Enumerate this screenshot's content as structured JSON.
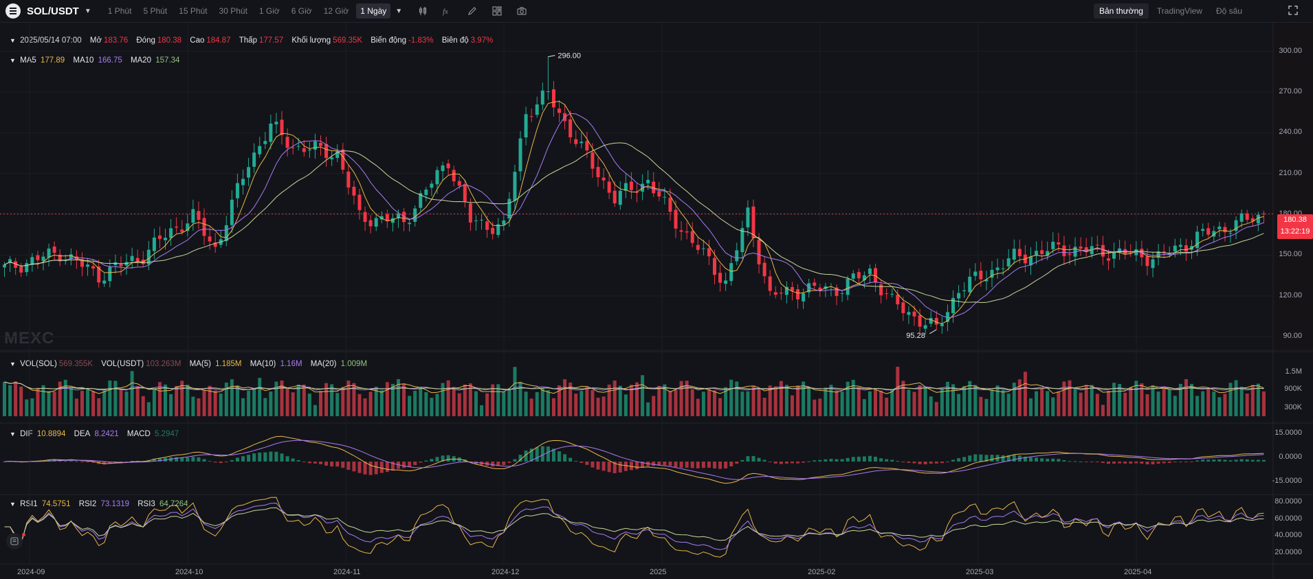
{
  "header": {
    "symbol": "SOL/USDT",
    "intervals": [
      "1 Phút",
      "5 Phút",
      "15 Phút",
      "30 Phút",
      "1 Giờ",
      "6 Giờ",
      "12 Giờ",
      "1 Ngày"
    ],
    "active_interval": "1 Ngày",
    "views": [
      "Bản thường",
      "TradingView",
      "Độ sâu"
    ],
    "active_view": "Bản thường",
    "tool_icons": [
      "candle-type-icon",
      "indicator-fx-icon",
      "draw-pencil-icon",
      "layout-grid-icon",
      "camera-icon"
    ]
  },
  "ohlc": {
    "date": "2025/05/14 07:00",
    "open_label": "Mở",
    "open": "183.76",
    "close_label": "Đóng",
    "close": "180.38",
    "high_label": "Cao",
    "high": "184.87",
    "low_label": "Thấp",
    "low": "177.57",
    "volume_label": "Khối lượng",
    "volume": "569.35K",
    "change_label": "Biến động",
    "change": "-1.83%",
    "amplitude_label": "Biên độ",
    "amplitude": "3.97%"
  },
  "ma": {
    "ma5_label": "MA5",
    "ma5": "177.89",
    "ma10_label": "MA10",
    "ma10": "166.75",
    "ma20_label": "MA20",
    "ma20": "157.34"
  },
  "volume_panel": {
    "sol_label": "VOL(SOL)",
    "sol": "569.355K",
    "usdt_label": "VOL(USDT)",
    "usdt": "103.263M",
    "ma5_label": "MA(5)",
    "ma5": "1.185M",
    "ma10_label": "MA(10)",
    "ma10": "1.16M",
    "ma20_label": "MA(20)",
    "ma20": "1.009M",
    "y_ticks": [
      "1.5M",
      "900K",
      "300K"
    ]
  },
  "macd_panel": {
    "dif_label": "DIF",
    "dif": "10.8894",
    "dea_label": "DEA",
    "dea": "8.2421",
    "macd_label": "MACD",
    "macd": "5.2947",
    "y_ticks": [
      "15.0000",
      "0.0000",
      "-15.0000"
    ]
  },
  "rsi_panel": {
    "rsi1_label": "RSI1",
    "rsi1": "74.5751",
    "rsi2_label": "RSI2",
    "rsi2": "73.1319",
    "rsi3_label": "RSI3",
    "rsi3": "64.7264",
    "y_ticks": [
      "80.0000",
      "60.0000",
      "40.0000",
      "20.0000"
    ]
  },
  "price_axis": {
    "ticks": [
      "300.00",
      "270.00",
      "240.00",
      "210.00",
      "180.00",
      "150.00",
      "120.00",
      "90.00"
    ],
    "current_price": "180.38",
    "countdown": "13:22:19"
  },
  "annotations": {
    "max_label": "296.00",
    "min_label": "95.28"
  },
  "x_axis": [
    "2024-09",
    "2024-10",
    "2024-11",
    "2024-12",
    "2025",
    "2025-02",
    "2025-03",
    "2025-04"
  ],
  "watermark": "MEXC",
  "colors": {
    "up": "#22ab94",
    "down": "#f23645",
    "ma5": "#e9b84b",
    "ma10": "#a97cf6",
    "ma20": "#c8d79a",
    "background": "#131419"
  },
  "chart_data": {
    "type": "candlestick",
    "price_range": [
      80,
      315
    ],
    "max_annotation": 296.0,
    "min_annotation": 95.28,
    "current_price": 180.38,
    "x_ticks": [
      "2024-09",
      "2024-10",
      "2024-11",
      "2024-12",
      "2025",
      "2025-02",
      "2025-03",
      "2025-04"
    ],
    "anchor_closes": [
      [
        0,
        140
      ],
      [
        10,
        152
      ],
      [
        17,
        135
      ],
      [
        25,
        150
      ],
      [
        30,
        168
      ],
      [
        34,
        178
      ],
      [
        38,
        155
      ],
      [
        44,
        218
      ],
      [
        48,
        245
      ],
      [
        52,
        230
      ],
      [
        60,
        225
      ],
      [
        64,
        178
      ],
      [
        72,
        175
      ],
      [
        80,
        220
      ],
      [
        84,
        175
      ],
      [
        90,
        170
      ],
      [
        94,
        255
      ],
      [
        98,
        268
      ],
      [
        104,
        228
      ],
      [
        110,
        192
      ],
      [
        116,
        205
      ],
      [
        120,
        180
      ],
      [
        130,
        130
      ],
      [
        134,
        180
      ],
      [
        138,
        120
      ],
      [
        144,
        125
      ],
      [
        150,
        125
      ],
      [
        156,
        138
      ],
      [
        160,
        115
      ],
      [
        168,
        95
      ],
      [
        172,
        125
      ],
      [
        182,
        148
      ],
      [
        190,
        155
      ],
      [
        200,
        152
      ],
      [
        208,
        148
      ],
      [
        216,
        165
      ],
      [
        227,
        180
      ]
    ]
  }
}
